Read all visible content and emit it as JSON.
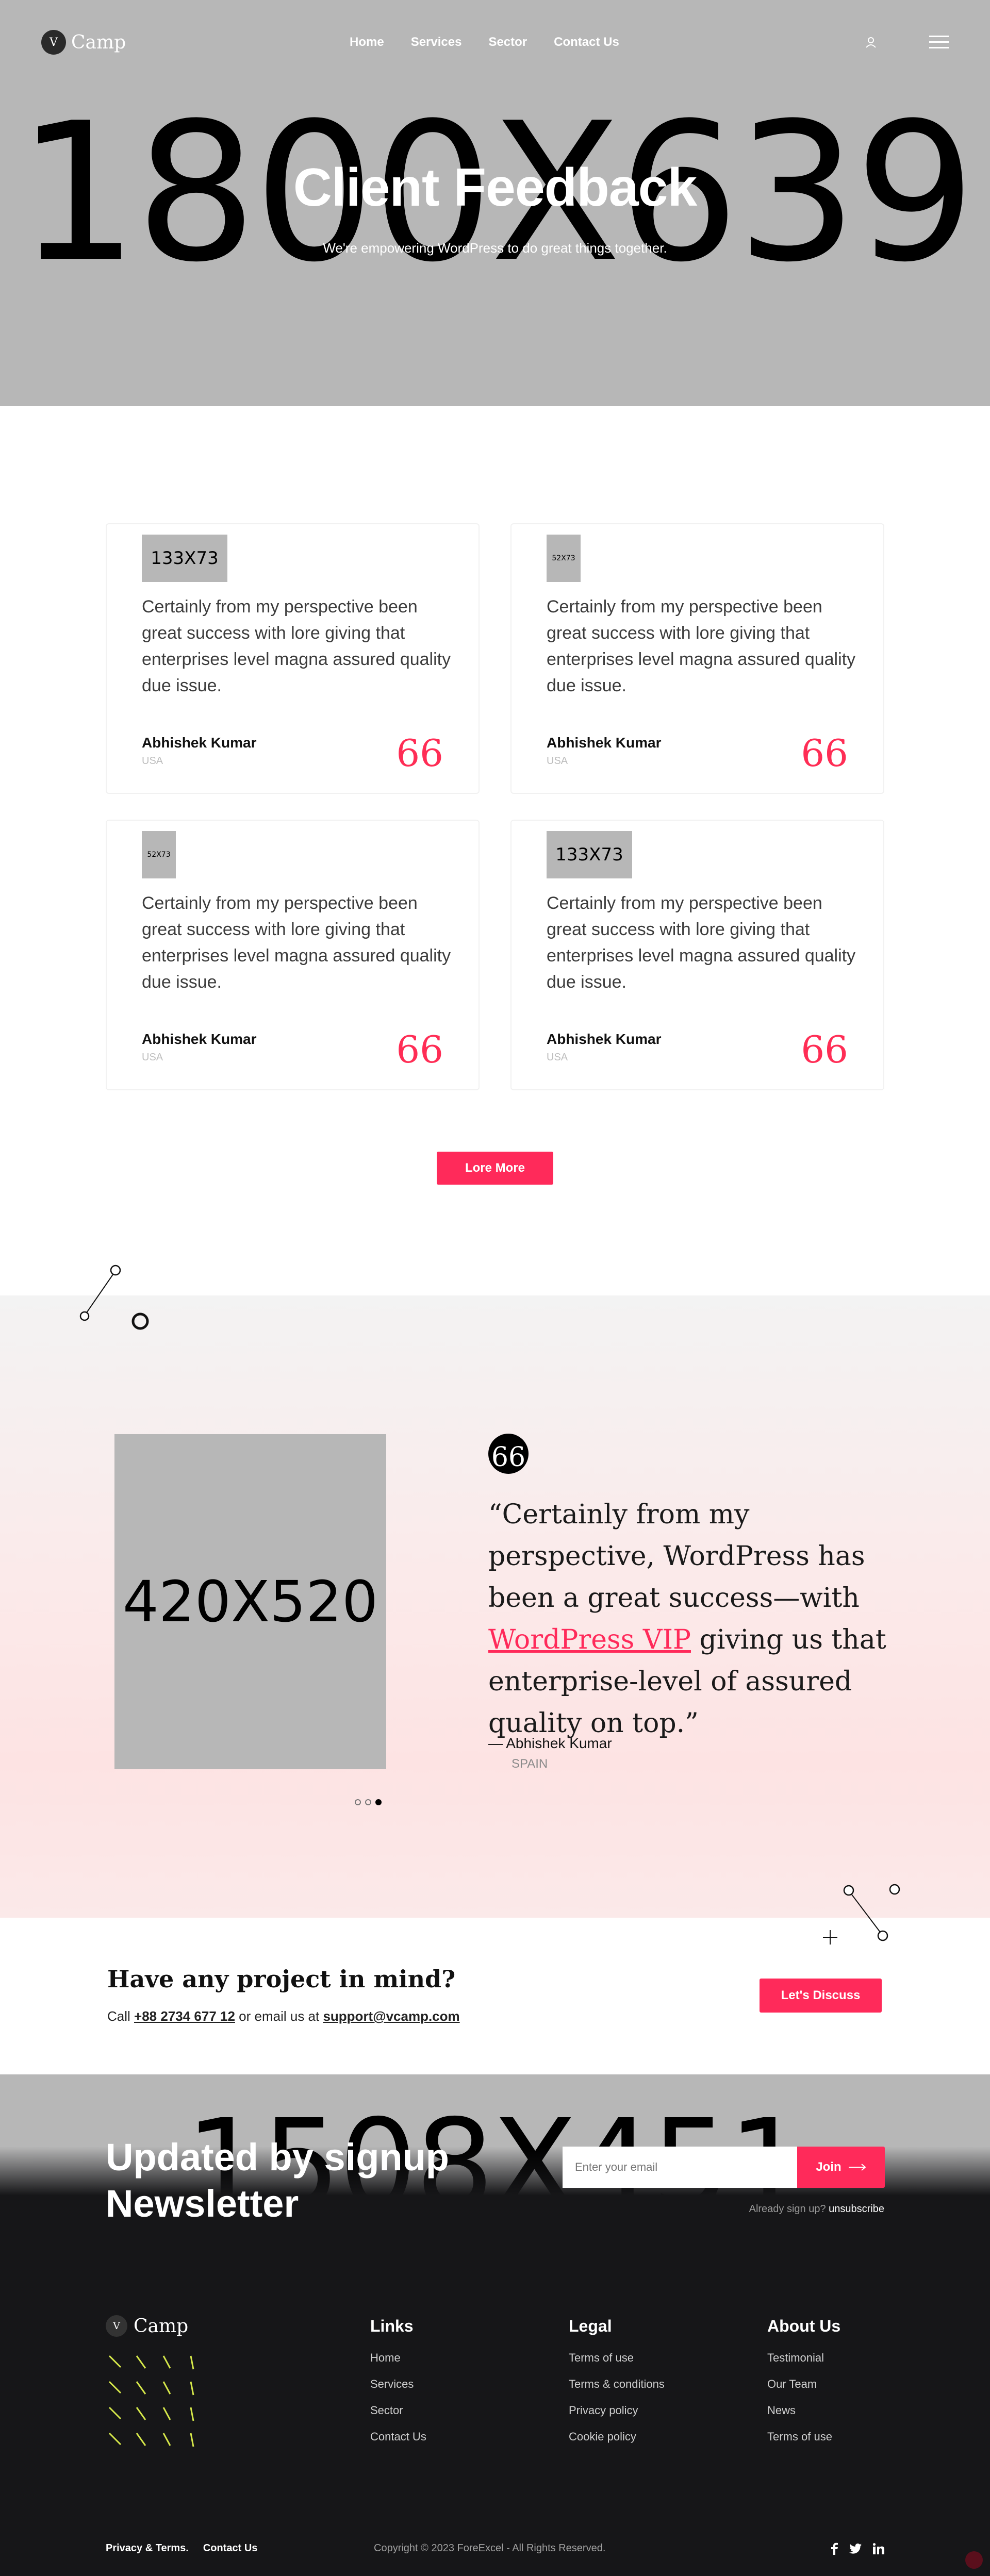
{
  "colors": {
    "accent": "#ff2a5a",
    "placeholder": "#b7b7b7",
    "footer_bg": "#161618"
  },
  "header": {
    "logo_letter": "V",
    "logo_text": "Camp",
    "nav": [
      "Home",
      "Services",
      "Sector",
      "Contact Us"
    ],
    "icons": [
      "user-icon",
      "hamburger-icon"
    ]
  },
  "hero": {
    "placeholder": "1800X639",
    "title": "Client Feedback",
    "subtitle": "We're empowering WordPress to do great things together."
  },
  "testimonials": [
    {
      "image": "133X73",
      "quote": "Certainly from my perspective been great success with lore giving that enterprises level magna assured quality due issue.",
      "name": "Abhishek Kumar",
      "location": "USA",
      "mark": "66"
    },
    {
      "image": "52X73",
      "quote": "Certainly from my perspective been great success with lore giving that enterprises level magna assured quality due issue.",
      "name": "Abhishek Kumar",
      "location": "USA",
      "mark": "66"
    },
    {
      "image": "52X73",
      "quote": "Certainly from my perspective been great success with lore giving that enterprises level magna assured quality due issue.",
      "name": "Abhishek Kumar",
      "location": "USA",
      "mark": "66"
    },
    {
      "image": "133X73",
      "quote": "Certainly from my perspective been great success with lore giving that enterprises level magna assured quality due issue.",
      "name": "Abhishek Kumar",
      "location": "USA",
      "mark": "66"
    }
  ],
  "lore_button": "Lore More",
  "feature": {
    "image": "420X520",
    "mark": "66",
    "quote_before": "“Certainly from my perspective, WordPress has been a great success—with ",
    "quote_link": "WordPress VIP",
    "quote_after": " giving us that enterprise-level of assured quality on top.”",
    "name": "—  Abhishek Kumar",
    "location": "SPAIN",
    "slides": 3,
    "active_slide": 3
  },
  "project": {
    "title": "Have any project in mind?",
    "call_prefix": "Call ",
    "phone": "+88 2734 677 12",
    "email_prefix": " or email us at ",
    "email": "support@vcamp.com",
    "button": "Let's Discuss"
  },
  "newsletter": {
    "placeholder_image": "1508X451",
    "title_line1": "Updated by signup",
    "title_line2": "Newsletter",
    "input_placeholder": "Enter your email",
    "join": "Join",
    "note_prefix": "Already sign up? ",
    "note_link": "unsubscribe"
  },
  "footer": {
    "logo_letter": "V",
    "logo_text": "Camp",
    "columns": [
      {
        "title": "Links",
        "items": [
          "Home",
          "Services",
          "Sector",
          "Contact Us"
        ]
      },
      {
        "title": "Legal",
        "items": [
          "Terms of use",
          "Terms & conditions",
          "Privacy policy",
          "Cookie policy"
        ]
      },
      {
        "title": "About Us",
        "items": [
          "Testimonial",
          "Our Team",
          "News",
          "Terms of use"
        ]
      }
    ],
    "bottom_links": [
      "Privacy & Terms.",
      "Contact Us"
    ],
    "copyright": "Copyright © 2023 ForeExcel - All Rights Reserved.",
    "social": [
      "facebook-icon",
      "twitter-icon",
      "linkedin-icon"
    ]
  }
}
